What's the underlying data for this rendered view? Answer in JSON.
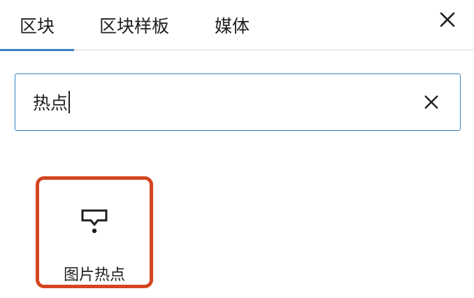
{
  "tabs": [
    {
      "label": "区块",
      "active": true
    },
    {
      "label": "区块样板",
      "active": false
    },
    {
      "label": "媒体",
      "active": false
    }
  ],
  "header": {
    "close_icon": "close-icon"
  },
  "search": {
    "value": "热点",
    "clear_icon": "close-icon"
  },
  "results": [
    {
      "label": "图片热点",
      "icon": "hotspot-icon",
      "highlight_color": "#d4451f"
    }
  ],
  "colors": {
    "accent": "#3582c4",
    "highlight": "#d4451f",
    "text": "#1e1e1e"
  }
}
